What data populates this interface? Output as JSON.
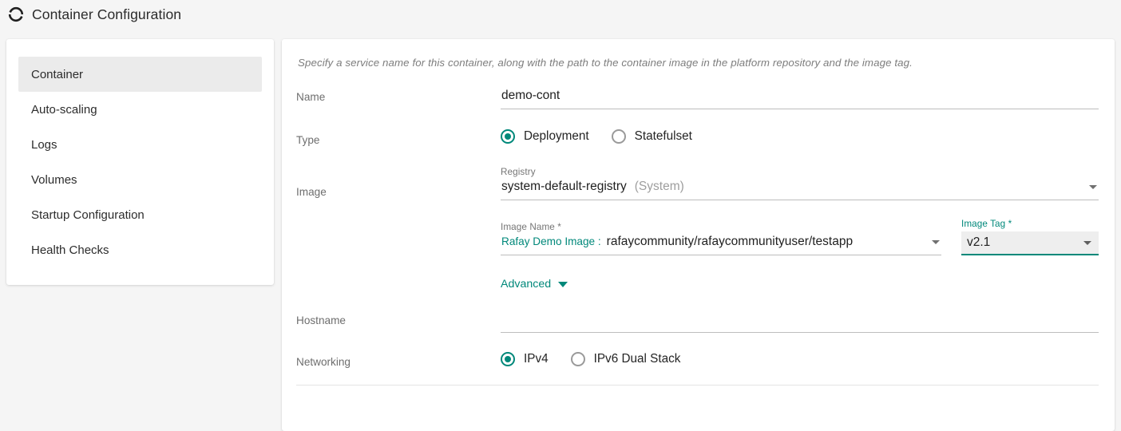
{
  "header": {
    "icon": "container-ring-icon",
    "title": "Container Configuration"
  },
  "sidebar": {
    "items": [
      {
        "label": "Container",
        "active": true
      },
      {
        "label": "Auto-scaling",
        "active": false
      },
      {
        "label": "Logs",
        "active": false
      },
      {
        "label": "Volumes",
        "active": false
      },
      {
        "label": "Startup Configuration",
        "active": false
      },
      {
        "label": "Health Checks",
        "active": false
      }
    ]
  },
  "form": {
    "description": "Specify a service name for this container, along with the path to the container image in the platform repository and the image tag.",
    "name": {
      "label": "Name",
      "value": "demo-cont",
      "placeholder": ""
    },
    "type": {
      "label": "Type",
      "options": [
        "Deployment",
        "Statefulset"
      ],
      "selected": "Deployment"
    },
    "image": {
      "label": "Image",
      "registry": {
        "caption": "Registry",
        "value": "system-default-registry",
        "suffix": "(System)",
        "caret": "chevron-down-icon"
      },
      "image_name": {
        "caption": "Image Name *",
        "prefix": "Rafay Demo Image :",
        "value": "rafaycommunity/rafaycommunityuser/testapp",
        "caret": "chevron-down-icon"
      },
      "image_tag": {
        "caption": "Image Tag *",
        "value": "v2.1",
        "caret": "chevron-down-icon",
        "focused": true
      },
      "advanced": {
        "label": "Advanced",
        "caret": "caret-down-icon"
      }
    },
    "hostname": {
      "label": "Hostname",
      "value": "",
      "placeholder": ""
    },
    "networking": {
      "label": "Networking",
      "options": [
        "IPv4",
        "IPv6 Dual Stack"
      ],
      "selected": "IPv4"
    }
  },
  "colors": {
    "accent": "#00887a",
    "page_background": "#f5f5f5",
    "card_background": "#ffffff",
    "active_nav_background": "#ebebeb",
    "label_text": "#6e6e6e"
  }
}
